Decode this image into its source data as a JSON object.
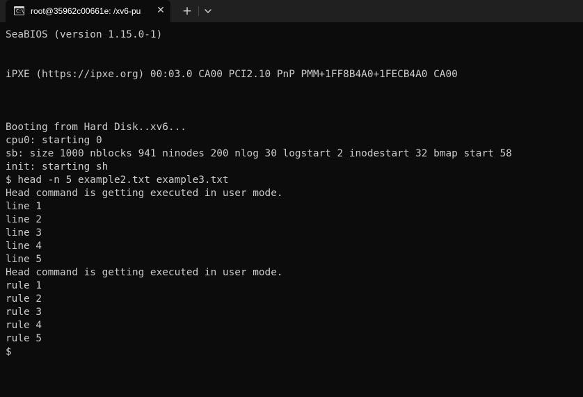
{
  "tab": {
    "icon_text": "C:\\",
    "title": "root@35962c00661e: /xv6-pu",
    "close_glyph": "✕"
  },
  "tabbar": {
    "new_tab_glyph": "+"
  },
  "terminal": {
    "lines": [
      "SeaBIOS (version 1.15.0-1)",
      "",
      "",
      "iPXE (https://ipxe.org) 00:03.0 CA00 PCI2.10 PnP PMM+1FF8B4A0+1FECB4A0 CA00",
      "",
      "",
      "",
      "Booting from Hard Disk..xv6...",
      "cpu0: starting 0",
      "sb: size 1000 nblocks 941 ninodes 200 nlog 30 logstart 2 inodestart 32 bmap start 58",
      "init: starting sh",
      "$ head -n 5 example2.txt example3.txt",
      "Head command is getting executed in user mode.",
      "line 1",
      "line 2",
      "line 3",
      "line 4",
      "line 5",
      "Head command is getting executed in user mode.",
      "rule 1",
      "rule 2",
      "rule 3",
      "rule 4",
      "rule 5",
      "$"
    ]
  }
}
